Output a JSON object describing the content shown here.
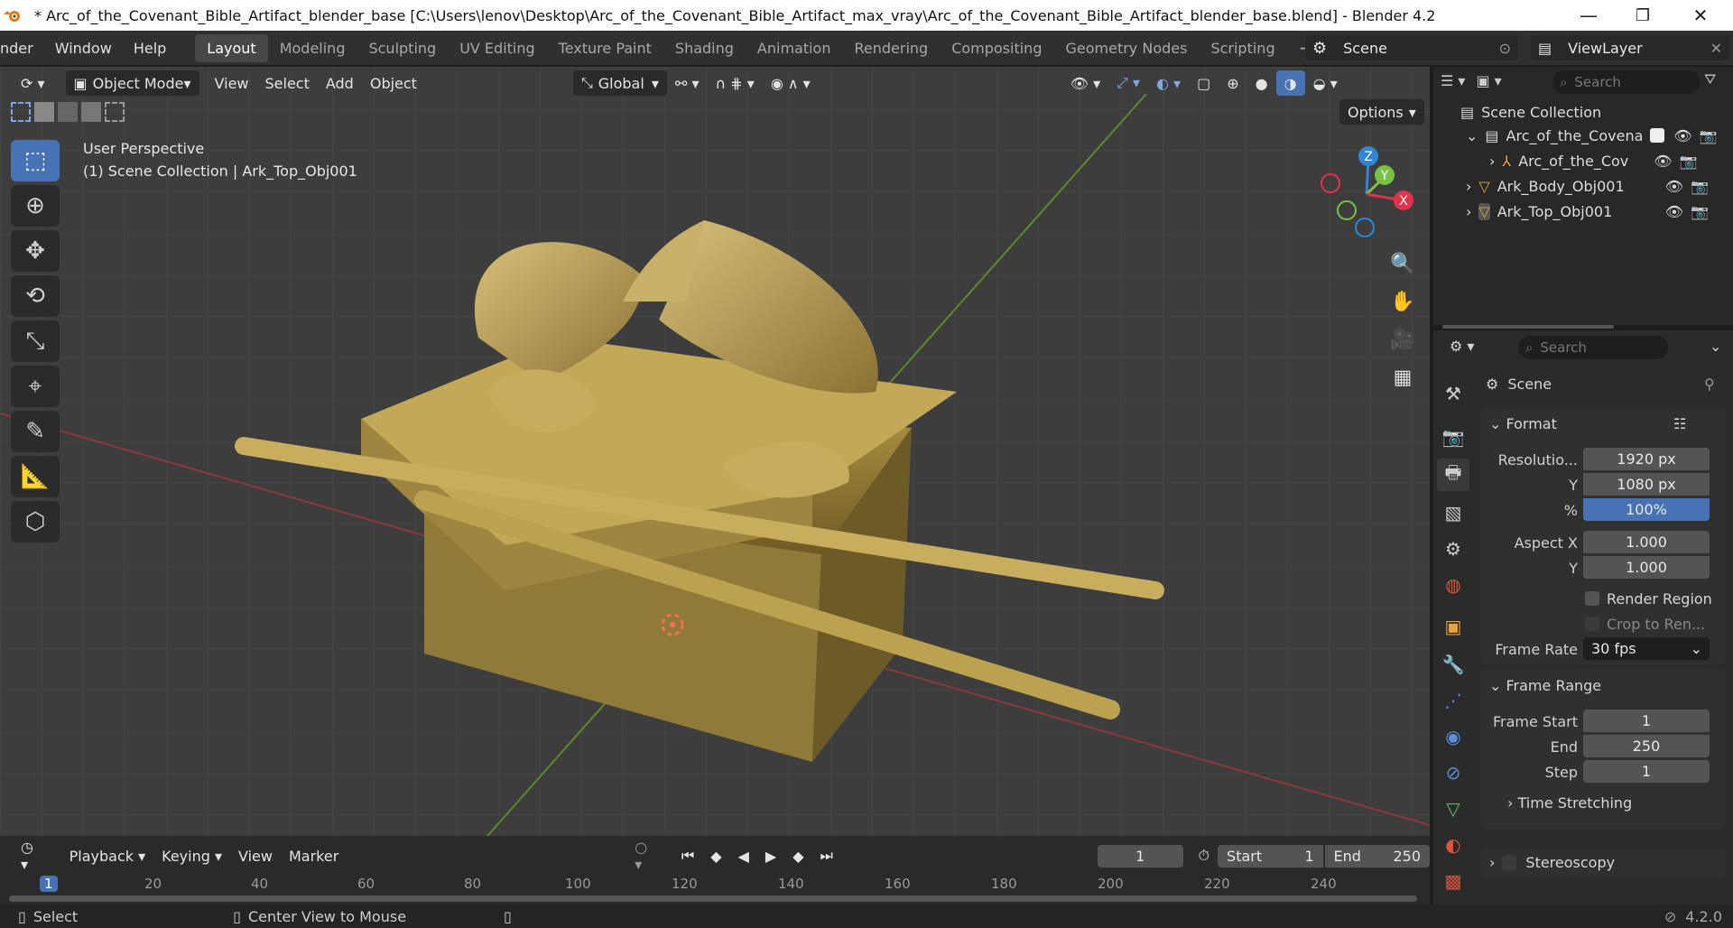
{
  "window": {
    "title": "* Arc_of_the_Covenant_Bible_Artifact_blender_base [C:\\Users\\lenov\\Desktop\\Arc_of_the_Covenant_Bible_Artifact_max_vray\\Arc_of_the_Covenant_Bible_Artifact_blender_base.blend] - Blender 4.2",
    "minimize": "—",
    "maximize": "❐",
    "close": "✕"
  },
  "menus": [
    "nder",
    "Window",
    "Help"
  ],
  "workspaces": [
    "Layout",
    "Modeling",
    "Sculpting",
    "UV Editing",
    "Texture Paint",
    "Shading",
    "Animation",
    "Rendering",
    "Compositing",
    "Geometry Nodes",
    "Scripting"
  ],
  "workspace_add": "+",
  "scene": "Scene",
  "view_layer": "ViewLayer",
  "viewport": {
    "mode": "Object Mode",
    "menus": [
      "View",
      "Select",
      "Add",
      "Object"
    ],
    "orientation": "Global",
    "options": "Options",
    "info_line1": "User Perspective",
    "info_line2": "(1) Scene Collection | Ark_Top_Obj001",
    "gizmo": {
      "z": "Z",
      "y": "Y",
      "x": "X"
    }
  },
  "outliner": {
    "search_placeholder": "Search",
    "rows": [
      {
        "label": "Scene Collection"
      },
      {
        "label": "Arc_of_the_Covena"
      },
      {
        "label": "Arc_of_the_Cov"
      },
      {
        "label": "Ark_Body_Obj001"
      },
      {
        "label": "Ark_Top_Obj001"
      }
    ]
  },
  "properties": {
    "search_placeholder": "Search",
    "context": "Scene",
    "format": {
      "title": "Format",
      "res_x_label": "Resolutio...",
      "res_x": "1920 px",
      "res_y_label": "Y",
      "res_y": "1080 px",
      "pct_label": "%",
      "pct": "100%",
      "aspect_x_label": "Aspect X",
      "aspect_x": "1.000",
      "aspect_y_label": "Y",
      "aspect_y": "1.000",
      "render_region": "Render Region",
      "crop": "Crop to Ren...",
      "frame_rate_label": "Frame Rate",
      "frame_rate": "30 fps"
    },
    "frame_range": {
      "title": "Frame Range",
      "start_label": "Frame Start",
      "start": "1",
      "end_label": "End",
      "end": "250",
      "step_label": "Step",
      "step": "1"
    },
    "time_stretching": "Time Stretching",
    "stereoscopy": "Stereoscopy"
  },
  "timeline": {
    "menus": [
      "Playback",
      "Keying",
      "View",
      "Marker"
    ],
    "current_frame": "1",
    "start_label": "Start",
    "start": "1",
    "end_label": "End",
    "end": "250",
    "ticks": [
      "1",
      "20",
      "40",
      "60",
      "80",
      "100",
      "120",
      "140",
      "160",
      "180",
      "200",
      "220",
      "240"
    ]
  },
  "status": {
    "select": "Select",
    "center_view": "Center View to Mouse",
    "version": "4.2.0"
  },
  "colors": {
    "accent": "#4772b3",
    "x_axis": "#e0334c",
    "y_axis": "#7ac143",
    "z_axis": "#2f86d9",
    "gold": "#b89a45"
  }
}
